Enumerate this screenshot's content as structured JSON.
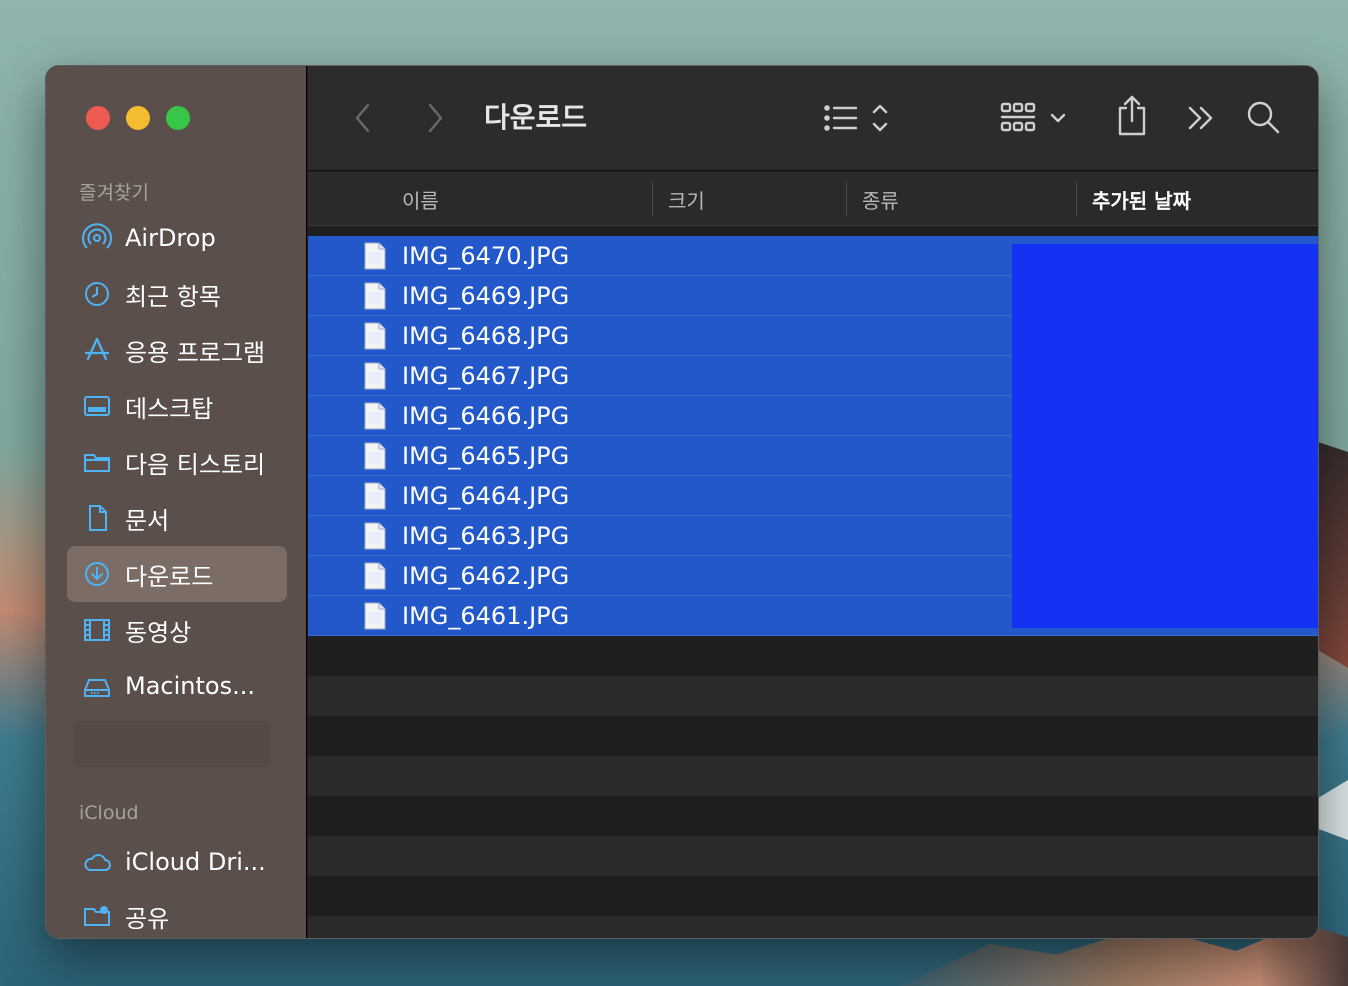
{
  "window": {
    "title": "다운로드"
  },
  "sidebar": {
    "favorites_label": "즐겨찾기",
    "items": [
      {
        "label": "AirDrop",
        "icon": "airdrop-icon"
      },
      {
        "label": "최근 항목",
        "icon": "clock-icon"
      },
      {
        "label": "응용 프로그램",
        "icon": "applications-icon"
      },
      {
        "label": "데스크탑",
        "icon": "desktop-icon"
      },
      {
        "label": "다음 티스토리",
        "icon": "folder-icon"
      },
      {
        "label": "문서",
        "icon": "document-icon"
      },
      {
        "label": "다운로드",
        "icon": "download-icon",
        "active": true
      },
      {
        "label": "동영상",
        "icon": "film-icon"
      },
      {
        "label": "Macintos...",
        "icon": "hard-drive-icon"
      }
    ],
    "icloud_label": "iCloud",
    "icloud_items": [
      {
        "label": "iCloud Dri...",
        "icon": "cloud-icon"
      },
      {
        "label": "공유",
        "icon": "shared-folder-icon"
      }
    ]
  },
  "columns": {
    "name": "이름",
    "size": "크기",
    "kind": "종류",
    "date_added": "추가된 날짜"
  },
  "files": [
    "IMG_6470.JPG",
    "IMG_6469.JPG",
    "IMG_6468.JPG",
    "IMG_6467.JPG",
    "IMG_6466.JPG",
    "IMG_6465.JPG",
    "IMG_6464.JPG",
    "IMG_6463.JPG",
    "IMG_6462.JPG",
    "IMG_6461.JPG"
  ],
  "colors": {
    "selection": "#2258c9",
    "redaction": "#1532f2",
    "sidebar_bg": "#5a4f4a"
  }
}
